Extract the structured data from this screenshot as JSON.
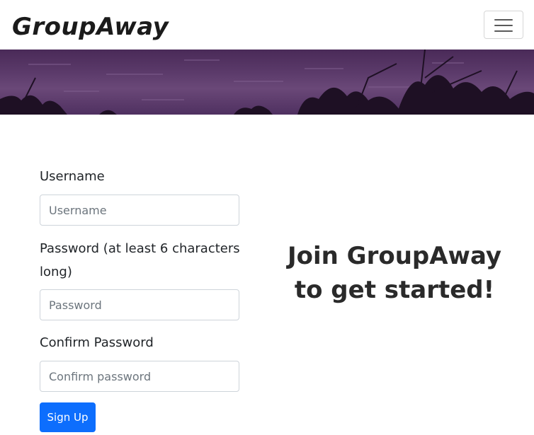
{
  "navbar": {
    "brand": "GroupAway",
    "toggler_icon": "hamburger-menu-icon"
  },
  "hero": {
    "image": "purple-tinted-lake-shore-banner"
  },
  "form": {
    "username": {
      "label": "Username",
      "placeholder": "Username",
      "value": ""
    },
    "password": {
      "label": "Password (at least 6 characters long)",
      "placeholder": "Password",
      "value": ""
    },
    "confirm_password": {
      "label": "Confirm Password",
      "placeholder": "Confirm password",
      "value": ""
    },
    "submit_label": "Sign Up"
  },
  "aside": {
    "headline": "Join GroupAway to get started!"
  },
  "colors": {
    "primary": "#0d6efd",
    "hero_tint": "#5b3a6a",
    "text": "#212529"
  }
}
